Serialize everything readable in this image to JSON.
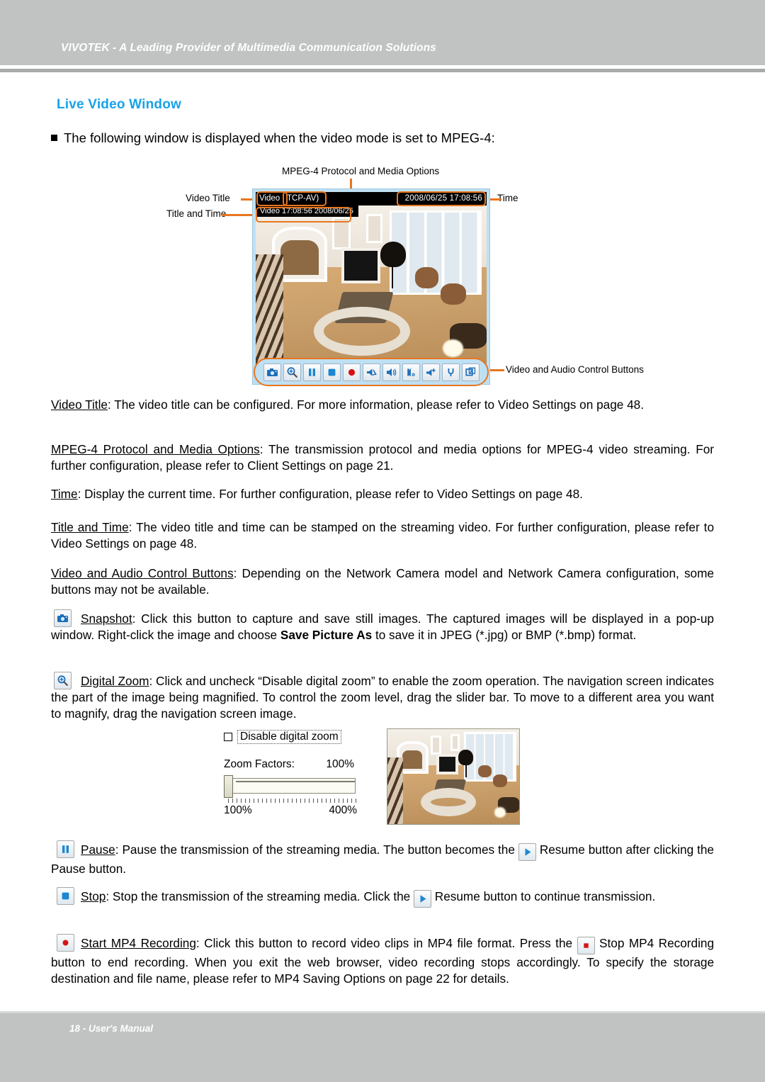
{
  "header": {
    "text": "VIVOTEK - A Leading Provider of Multimedia Communication Solutions"
  },
  "footer": {
    "text": "18 - User's Manual"
  },
  "page_title": "Live Video Window",
  "bullet": "The following window is displayed when the video mode is set to MPEG-4:",
  "figure": {
    "caption_top": "MPEG-4 Protocol and Media Options",
    "label_video_title": "Video Title",
    "label_title_and_time": "Title and Time",
    "label_time": "Time",
    "label_controls": "Video and Audio Control Buttons",
    "video_window": {
      "title": "Video",
      "protocol": "TCP-AV)",
      "time": "2008/06/25 17:08:56",
      "stamp": "Video 17:08:56  2008/06/25"
    },
    "buttons": [
      "snapshot-icon",
      "digital-zoom-icon",
      "pause-icon",
      "stop-icon",
      "record-icon",
      "speaker-mute-icon",
      "speaker-icon",
      "talk-icon",
      "mic-volume-icon",
      "microphone-icon",
      "fullscreen-icon"
    ]
  },
  "paragraphs": {
    "p1_term": "Video Title",
    "p1_body": ": The video title can be configured. For more information, please refer to Video Settings on page 48.",
    "p2_term": "MPEG-4 Protocol and Media Options",
    "p2_body": ": The transmission protocol and media options for MPEG-4 video streaming. For further configuration, please refer to Client Settings on page 21.",
    "p3_term": "Time",
    "p3_body": ": Display the current time. For further configuration, please refer to Video Settings on page 48.",
    "p4_term": "Title and Time",
    "p4_body": ": The video title and time can be stamped on the streaming video. For further configuration, please refer to Video Settings on page 48.",
    "p5_term": "Video and Audio Control Buttons",
    "p5_body": ": Depending on the Network Camera model and Network Camera configuration, some buttons may not be available.",
    "p6_term": "Snapshot",
    "p6_a": ": Click this button to capture and save still images. The captured images will be displayed in a pop-up window. Right-click the image and choose ",
    "p6_bold": "Save Picture As",
    "p6_b": " to save it in JPEG (*.jpg) or BMP (*.bmp) format.",
    "p7_term": "Digital Zoom",
    "p7_body": ": Click and uncheck “Disable digital zoom” to enable the zoom operation. The navigation screen indicates the part of the image being magnified. To control the zoom level, drag the slider bar. To move to a different area you want to magnify, drag the navigation screen image.",
    "p8_term": "Pause",
    "p8_a": ": Pause the transmission of the streaming media. The button becomes the ",
    "p8_b": " Resume button after clicking the Pause button.",
    "p9_term": "Stop",
    "p9_a": ": Stop the transmission of the streaming media. Click the ",
    "p9_b": " Resume button to continue transmission.",
    "p10_term": "Start MP4 Recording",
    "p10_a": ": Click this button to record video clips in MP4 file format. Press the ",
    "p10_b": " Stop MP4 Recording button to end recording. When you exit the web browser, video recording stops accordingly. To specify the storage destination and file name, please refer to MP4 Saving Options on page 22 for details."
  },
  "zoom_dialog": {
    "checkbox_label": "Disable digital zoom",
    "checked": false,
    "zoom_factors_label": "Zoom Factors:",
    "zoom_factors_value": "100%",
    "slider_min": "100%",
    "slider_max": "400%"
  },
  "colors": {
    "brand_blue": "#18a3e8",
    "callout_orange": "#e8761e",
    "band_grey": "#c1c3c3",
    "window_blue": "#bfe0f2"
  }
}
